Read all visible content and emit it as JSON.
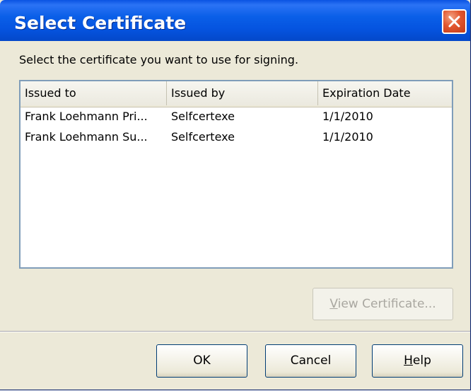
{
  "window": {
    "title": "Select Certificate"
  },
  "instruction": "Select the certificate you want to use for signing.",
  "table": {
    "columns": [
      "Issued to",
      "Issued by",
      "Expiration Date"
    ],
    "rows": [
      [
        "Frank Loehmann Pri...",
        "Selfcertexe",
        "1/1/2010"
      ],
      [
        "Frank Loehmann Su...",
        "Selfcertexe",
        "1/1/2010"
      ]
    ]
  },
  "buttons": {
    "view_certificate": {
      "mnemonic": "V",
      "rest": "iew Certificate..."
    },
    "ok": "OK",
    "cancel": "Cancel",
    "help": {
      "mnemonic": "H",
      "rest": "elp"
    }
  },
  "icons": {
    "close": "close-icon"
  },
  "colors": {
    "titlebar": "#0554e0",
    "dialog_bg": "#ece9d8",
    "close_button": "#e2562f"
  }
}
